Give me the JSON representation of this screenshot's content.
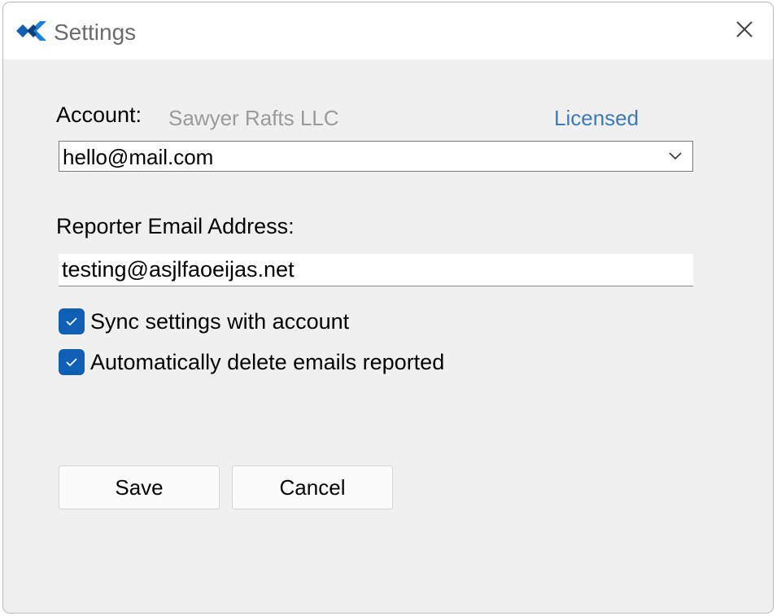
{
  "window": {
    "title": "Settings",
    "app_icon": "app-logo-icon",
    "close_icon": "close-icon"
  },
  "account": {
    "label": "Account:",
    "name": "Sawyer Rafts LLC",
    "status": "Licensed",
    "selected": "hello@mail.com"
  },
  "reporter": {
    "label": "Reporter Email Address:",
    "value": "testing@asjlfaoeijas.net"
  },
  "options": [
    {
      "label": "Sync settings with account",
      "checked": true
    },
    {
      "label": "Automatically delete emails reported",
      "checked": true
    }
  ],
  "buttons": {
    "save": "Save",
    "cancel": "Cancel"
  },
  "colors": {
    "accent": "#0f5fb5",
    "link": "#3c7ab8",
    "background": "#f0f0f0"
  }
}
